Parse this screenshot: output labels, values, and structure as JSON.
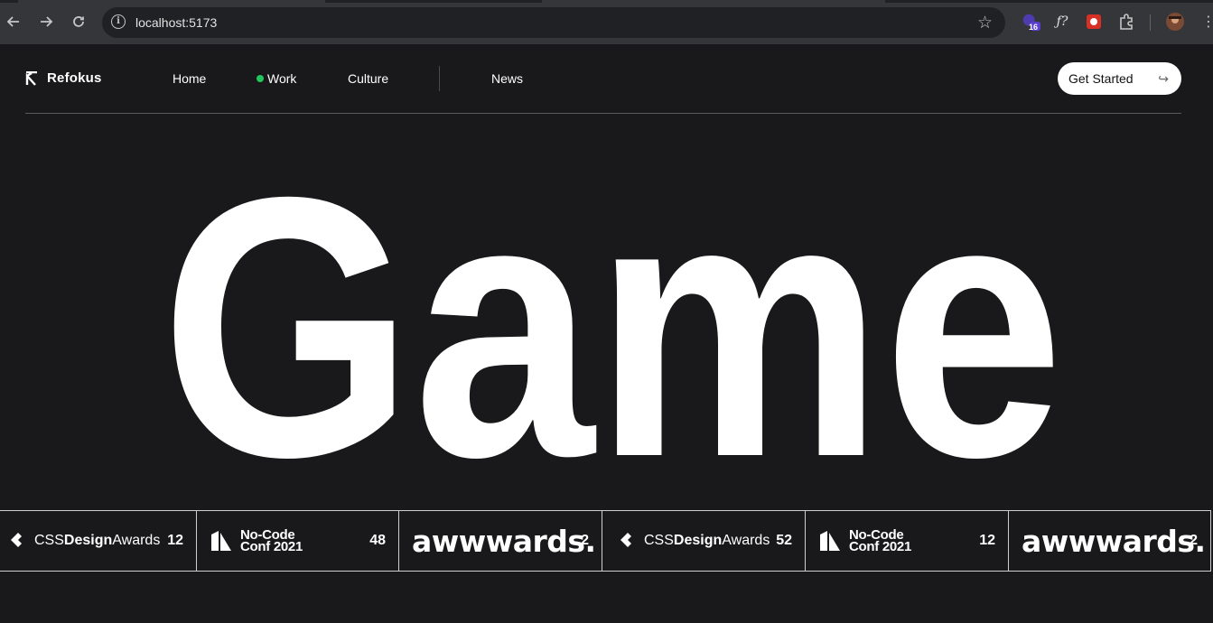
{
  "browser": {
    "url": "localhost:5173",
    "extension_badge": "16",
    "icons": [
      "back-arrow-icon",
      "forward-arrow-icon",
      "reload-icon",
      "site-info-icon",
      "bookmark-star-icon",
      "extension-icon",
      "function-icon",
      "app-icon",
      "puzzle-icon",
      "profile-avatar",
      "menu-icon"
    ]
  },
  "site": {
    "brand": "Refokus",
    "nav": {
      "home": "Home",
      "work": "Work",
      "culture": "Culture",
      "news": "News"
    },
    "cta": "Get Started",
    "cta_arrow": "↪",
    "accent_dot_color": "#22c55e"
  },
  "hero": {
    "word": "Game"
  },
  "awards": [
    {
      "logo": "cssdesignawards",
      "prefix": "CSS",
      "bold": "Design",
      "suffix": "Awards",
      "count": "12"
    },
    {
      "logo": "nocode",
      "line1": "No-Code",
      "line2": "Conf 2021",
      "count": "48"
    },
    {
      "logo": "awwwards",
      "text": "awwwards.",
      "count": "2"
    },
    {
      "logo": "cssdesignawards",
      "prefix": "CSS",
      "bold": "Design",
      "suffix": "Awards",
      "count": "52"
    },
    {
      "logo": "nocode",
      "line1": "No-Code",
      "line2": "Conf 2021",
      "count": "12"
    },
    {
      "logo": "awwwards",
      "text": "awwwards.",
      "count": "2"
    }
  ]
}
